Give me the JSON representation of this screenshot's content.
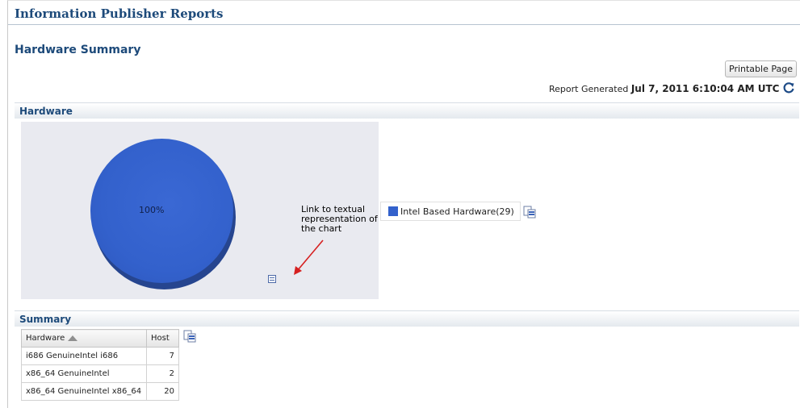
{
  "app": {
    "title": "Information Publisher Reports"
  },
  "page": {
    "title": "Hardware Summary"
  },
  "toolbar": {
    "printable_label": "Printable Page"
  },
  "report": {
    "generated_label": "Report Generated",
    "generated_date": "Jul 7, 2011 6:10:04 AM UTC"
  },
  "hardware_section": {
    "title": "Hardware"
  },
  "chart_data": {
    "type": "pie",
    "categories": [
      "Intel Based Hardware"
    ],
    "values": [
      29
    ],
    "slice_labels": [
      "100%"
    ],
    "legend": [
      "Intel Based Hardware(29)"
    ],
    "colors": [
      "#3361cc"
    ],
    "legend_position": "right"
  },
  "annotation": {
    "text": "Link to textual representation of the chart"
  },
  "summary_section": {
    "title": "Summary",
    "columns": [
      "Hardware",
      "Host"
    ],
    "rows": [
      {
        "hardware": "i686 GenuineIntel i686",
        "host": "7"
      },
      {
        "hardware": "x86_64 GenuineIntel",
        "host": "2"
      },
      {
        "hardware": "x86_64 GenuineIntel x86_64",
        "host": "20"
      }
    ]
  },
  "icons": {
    "refresh": "refresh-icon",
    "export": "export-excel-icon",
    "table_view": "table-view-icon",
    "sort": "sort-ascending-icon"
  },
  "colors": {
    "heading": "#1d4a7a",
    "pie": "#3361cc",
    "chart_bg": "#e9eaf0"
  }
}
